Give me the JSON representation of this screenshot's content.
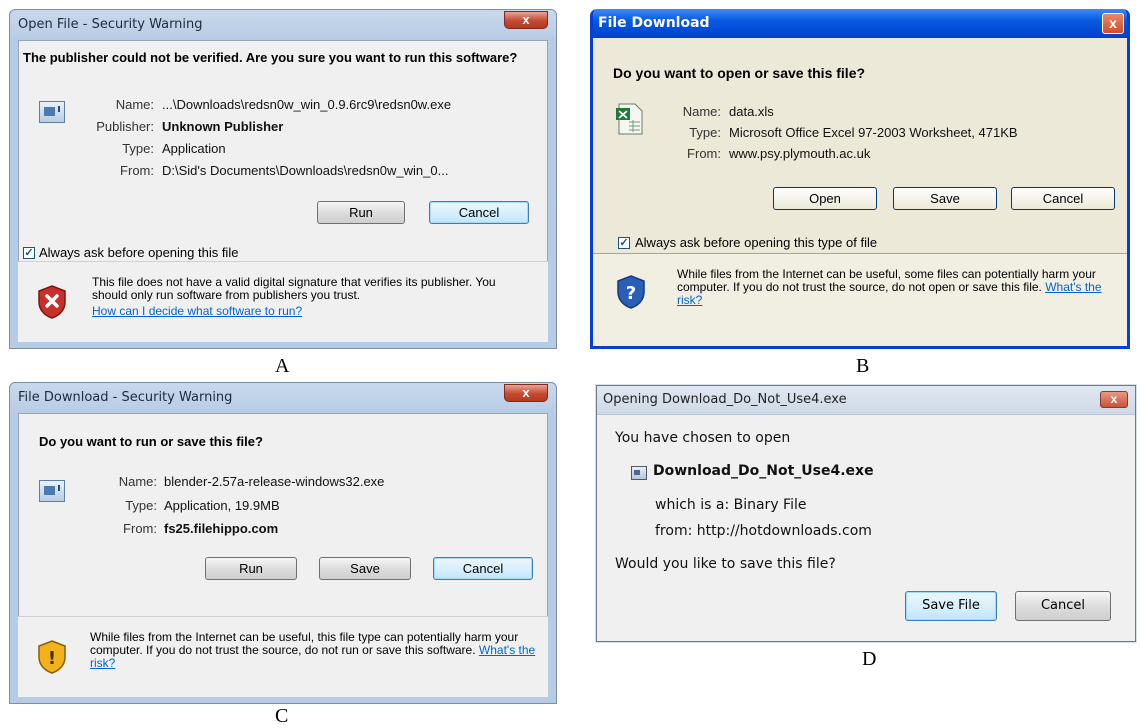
{
  "dialog_a": {
    "title": "Open File - Security Warning",
    "close_symbol": "x",
    "question": "The publisher could not be verified.  Are you sure you want to run this software?",
    "fields": [
      {
        "label": "Name:",
        "value": "...\\Downloads\\redsn0w_win_0.9.6rc9\\redsn0w.exe"
      },
      {
        "label": "Publisher:",
        "value": "Unknown Publisher"
      },
      {
        "label": "Type:",
        "value": "Application"
      },
      {
        "label": "From:",
        "value": "D:\\Sid's Documents\\Downloads\\redsn0w_win_0..."
      }
    ],
    "buttons": {
      "run": "Run",
      "cancel": "Cancel"
    },
    "checkbox_label": "Always ask before opening this file",
    "checkbox_checked": true,
    "warning_text": "This file does not have a valid digital signature that verifies its publisher.  You should only run software from publishers you trust.",
    "link_text": "How can I decide what software to run?",
    "warning_icon": "red-shield-x-icon"
  },
  "dialog_b": {
    "title": "File Download",
    "close_symbol": "x",
    "question": "Do you want to open or save this file?",
    "file_icon": "excel-file-icon",
    "fields": [
      {
        "label": "Name:",
        "value": "data.xls"
      },
      {
        "label": "Type:",
        "value": "Microsoft Office Excel 97-2003 Worksheet, 471KB"
      },
      {
        "label": "From:",
        "value": "www.psy.plymouth.ac.uk"
      }
    ],
    "buttons": {
      "open": "Open",
      "save": "Save",
      "cancel": "Cancel"
    },
    "checkbox_label": "Always ask before opening this type of file",
    "checkbox_checked": true,
    "warning_text": "While files from the Internet can be useful, some files can potentially harm your computer. If you do not trust the source, do not open or save this file.",
    "link_text": "What's the risk?",
    "warning_icon": "blue-shield-question-icon"
  },
  "dialog_c": {
    "title": "File Download - Security Warning",
    "close_symbol": "x",
    "question": "Do you want to run or save this file?",
    "fields": [
      {
        "label": "Name:",
        "value": "blender-2.57a-release-windows32.exe"
      },
      {
        "label": "Type:",
        "value": "Application, 19.9MB"
      },
      {
        "label": "From:",
        "value": "fs25.filehippo.com"
      }
    ],
    "buttons": {
      "run": "Run",
      "save": "Save",
      "cancel": "Cancel"
    },
    "warning_text": "While files from the Internet can be useful, this file type can potentially harm your computer. If you do not trust the source, do not run or save this software.",
    "link_text": "What's the risk?",
    "warning_icon": "yellow-shield-exclamation-icon"
  },
  "dialog_d": {
    "title": "Opening Download_Do_Not_Use4.exe",
    "close_symbol": "x",
    "intro": "You have chosen to open",
    "filename": "Download_Do_Not_Use4.exe",
    "which_is": "which is a:  Binary File",
    "from": "from:  http://hotdownloads.com",
    "question": "Would you like to save this file?",
    "buttons": {
      "save": "Save File",
      "cancel": "Cancel"
    }
  },
  "captions": {
    "a": "A",
    "b": "B",
    "c": "C",
    "d": "D"
  },
  "colors": {
    "vista_frame": "#b6cbe4",
    "xp_titlebar": "#0859e0",
    "link": "#0066cc",
    "default_button": "#bee6fd"
  }
}
